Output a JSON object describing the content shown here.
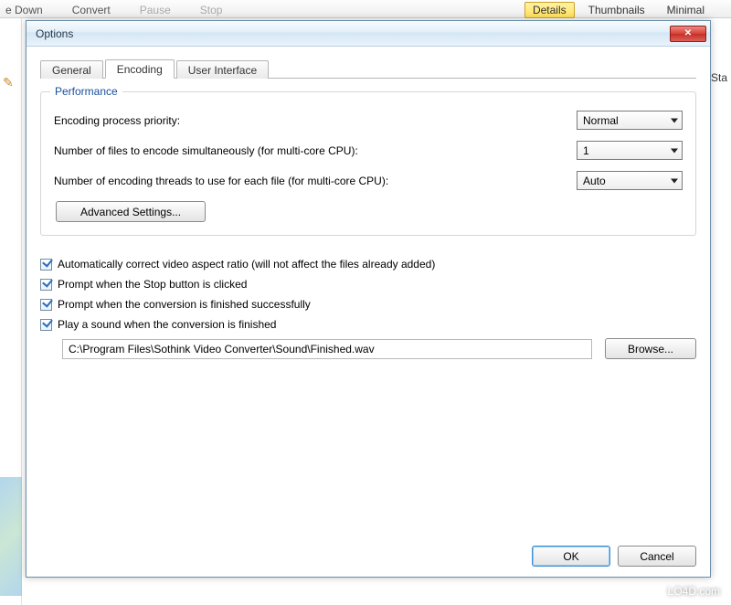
{
  "background": {
    "menu": {
      "down": "e Down",
      "convert": "Convert",
      "pause": "Pause",
      "stop": "Stop"
    },
    "views": {
      "details": "Details",
      "thumbnails": "Thumbnails",
      "minimal": "Minimal"
    },
    "right_col_hint": "Sta",
    "watermark": "LO4D.com"
  },
  "dialog": {
    "title": "Options",
    "tabs": {
      "general": "General",
      "encoding": "Encoding",
      "ui": "User Interface"
    },
    "performance": {
      "legend": "Performance",
      "priority_label": "Encoding process priority:",
      "priority_value": "Normal",
      "simul_label": "Number of files to encode simultaneously (for multi-core CPU):",
      "simul_value": "1",
      "threads_label": "Number of encoding threads to use for each file (for multi-core CPU):",
      "threads_value": "Auto",
      "advanced_btn": "Advanced Settings..."
    },
    "checks": {
      "aspect": "Automatically correct video aspect ratio (will not affect the files already added)",
      "stop": "Prompt when the Stop button is clicked",
      "finish_ok": "Prompt when the conversion is finished successfully",
      "play_sound": "Play a sound when the conversion is finished"
    },
    "sound_path": "C:\\Program Files\\Sothink Video Converter\\Sound\\Finished.wav",
    "browse_btn": "Browse...",
    "ok_btn": "OK",
    "cancel_btn": "Cancel"
  }
}
